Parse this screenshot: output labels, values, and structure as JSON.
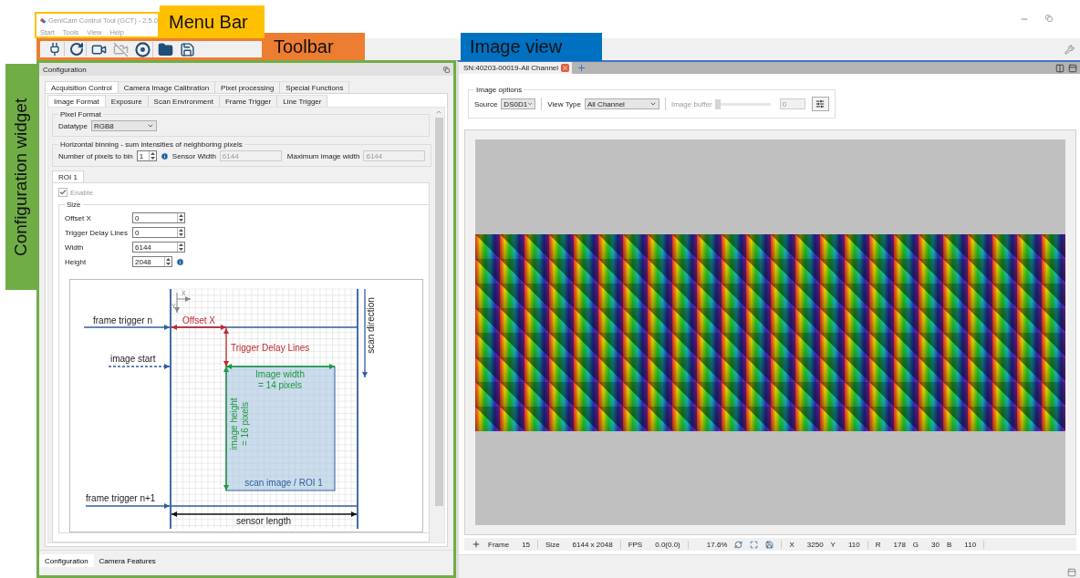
{
  "callouts": {
    "menu_bar": "Menu Bar",
    "toolbar": "Toolbar",
    "image_view": "Image view",
    "configuration_widget": "Configuration widget"
  },
  "window": {
    "title": "GeniCam Control Tool (GCT) - 2.5.0"
  },
  "menu": [
    "Start",
    "Tools",
    "View",
    "Help"
  ],
  "config": {
    "title": "Configuration",
    "tabs": [
      {
        "label": "Acquisition Control",
        "selected": true
      },
      {
        "label": "Camera Image Calibration",
        "selected": false
      },
      {
        "label": "Pixel processing",
        "selected": false
      },
      {
        "label": "Special Functions",
        "selected": false
      }
    ],
    "subtabs": [
      {
        "label": "Image Format",
        "selected": true
      },
      {
        "label": "Exposure",
        "selected": false
      },
      {
        "label": "Scan Environment",
        "selected": false
      },
      {
        "label": "Frame Trigger",
        "selected": false
      },
      {
        "label": "Line Trigger",
        "selected": false
      }
    ],
    "pixel_format": {
      "legend": "Pixel Format",
      "datatype_label": "Datatype",
      "datatype_value": "RGB8"
    },
    "binning": {
      "legend": "Horizontal binning - sum intensities of neighboring pixels",
      "bin_label": "Number of pixels to bin",
      "bin_value": "1",
      "sensor_width_label": "Sensor Width",
      "sensor_width_value": "6144",
      "max_width_label": "Maximum image width",
      "max_width_value": "6144"
    },
    "roi_tabs": [
      {
        "label": "ROI 1",
        "selected": true
      }
    ],
    "enable": {
      "label": "Enable",
      "checked": true,
      "disabled": true
    },
    "size": {
      "legend": "Size",
      "fields": [
        {
          "label": "Offset X",
          "value": "0",
          "info": false
        },
        {
          "label": "Trigger Delay Lines",
          "value": "0",
          "info": false
        },
        {
          "label": "Width",
          "value": "6144",
          "info": false
        },
        {
          "label": "Height",
          "value": "2048",
          "info": true
        }
      ]
    },
    "diagram": {
      "axis_x": "X",
      "axis_y": "Y",
      "frame_trigger_n": "frame trigger n",
      "image_start": "image start",
      "frame_trigger_next": "frame trigger n+1",
      "offset_x": "Offset X",
      "trigger_delay": "Trigger Delay Lines",
      "image_width": [
        "Image width",
        "= 14 pixels"
      ],
      "image_height": [
        "image height",
        "= 16 pixels"
      ],
      "roi_label": "scan image / ROI 1",
      "sensor_length": "sensor length",
      "scan_direction": "scan direction"
    },
    "bottom_tabs": [
      {
        "label": "Configuration",
        "selected": true
      },
      {
        "label": "Camera Features",
        "selected": false
      }
    ]
  },
  "image_view": {
    "tab": {
      "label": "SN:40203-00019-All Channel"
    },
    "options": {
      "legend": "Image options",
      "source_label": "Source",
      "source_value": "DS0D1",
      "view_type_label": "View Type",
      "view_type_value": "All Channel",
      "buffer_label": "Image buffer",
      "buffer_value": "0",
      "buffer_disabled": true,
      "level": 0
    },
    "status": [
      {
        "kind": "readout",
        "items": [
          {
            "label": "Frame",
            "value": "15"
          }
        ]
      },
      {
        "kind": "readout",
        "items": [
          {
            "label": "Size",
            "value": "6144 x 2048"
          }
        ]
      },
      {
        "kind": "readout",
        "items": [
          {
            "label": "FPS",
            "value": "0.0(0.0)"
          }
        ]
      },
      {
        "kind": "zoom",
        "value": "17.6%"
      },
      {
        "kind": "readout",
        "items": [
          {
            "label": "X",
            "value": "3250"
          },
          {
            "label": "Y",
            "value": "110"
          }
        ]
      },
      {
        "kind": "readout",
        "items": [
          {
            "label": "R",
            "value": "178"
          },
          {
            "label": "G",
            "value": "30"
          },
          {
            "label": "B",
            "value": "110"
          }
        ]
      }
    ]
  }
}
